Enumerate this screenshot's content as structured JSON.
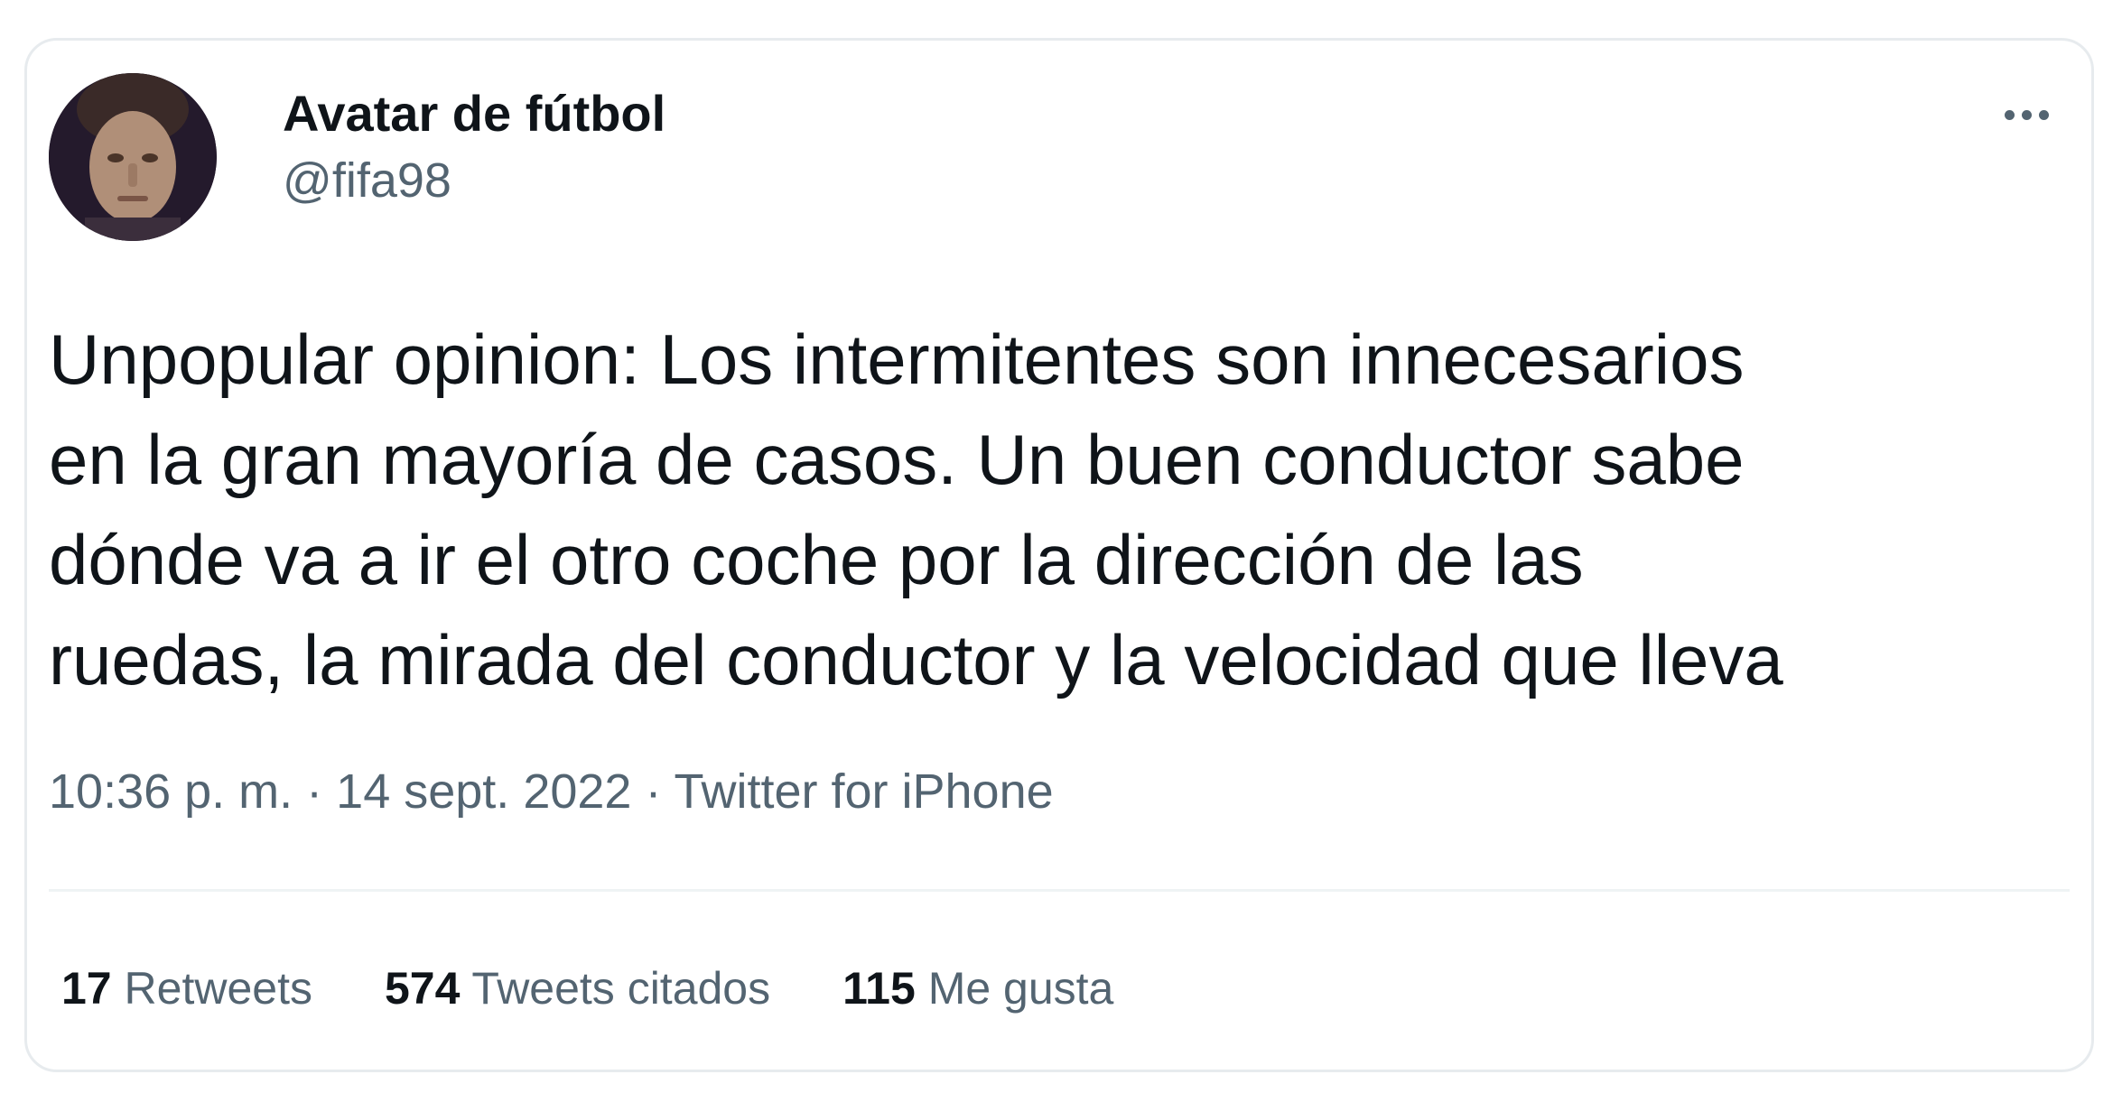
{
  "author": {
    "display_name": "Avatar de fútbol",
    "handle": "@fifa98"
  },
  "tweet": {
    "lines": [
      "Unpopular opinion: Los intermitentes son innecesarios",
      "en la gran mayoría de casos. Un buen conductor sabe",
      "dónde va a ir el otro coche por la dirección de las",
      "ruedas, la mirada del conductor y la velocidad que lleva"
    ]
  },
  "meta": {
    "time": "10:36 p. m.",
    "separator": " · ",
    "date": "14 sept. 2022",
    "source": "Twitter for iPhone"
  },
  "stats": {
    "retweets": {
      "count": "17",
      "label": "Retweets"
    },
    "quotes": {
      "count": "574",
      "label": "Tweets citados"
    },
    "likes": {
      "count": "115",
      "label": "Me gusta"
    }
  },
  "icons": {
    "more": "more-horizontal-icon"
  },
  "colors": {
    "text_primary": "#0f1419",
    "text_secondary": "#536471",
    "border": "#e7ebee"
  }
}
